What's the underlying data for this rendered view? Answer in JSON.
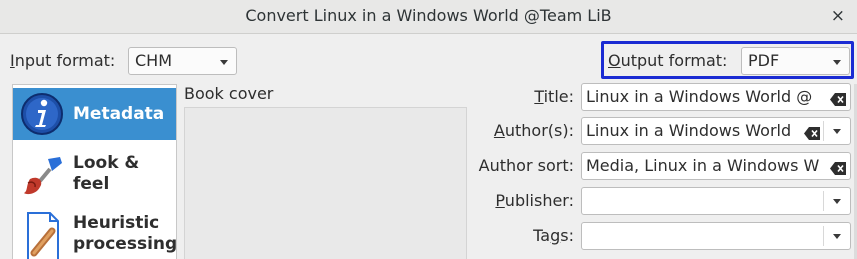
{
  "window": {
    "title": "Convert Linux in a Windows World @Team LiB",
    "close_glyph": "×"
  },
  "input_format": {
    "label_u": "I",
    "label_rest": "nput format:",
    "value": "CHM"
  },
  "output_format": {
    "label_u": "O",
    "label_rest": "utput format:",
    "value": "PDF"
  },
  "sidebar": {
    "items": [
      {
        "label": "Metadata",
        "icon": "info-icon",
        "selected": true
      },
      {
        "label_line1": "Look &",
        "label_line2": "feel",
        "icon": "paintbrush-icon"
      },
      {
        "label_line1": "Heuristic",
        "label_line2": "processing",
        "icon": "document-wrench-icon"
      }
    ]
  },
  "book_cover": {
    "label": "Book cover"
  },
  "metadata": {
    "title": {
      "label_u": "T",
      "label_rest": "itle:",
      "value": "Linux in a Windows World @"
    },
    "authors": {
      "label_u": "A",
      "label_rest": "uthor(s):",
      "value": "Linux in a Windows World"
    },
    "author_sort": {
      "label": "Author sort:",
      "value": "Media, Linux in a Windows W"
    },
    "publisher": {
      "label_u": "P",
      "label_rest": "ublisher:",
      "value": ""
    },
    "tags": {
      "label_pre": "Ta",
      "label_u": "g",
      "label_rest": "s:",
      "value": ""
    }
  },
  "colors": {
    "accent": "#3a8fd0",
    "focus": "#1a2bd3"
  }
}
